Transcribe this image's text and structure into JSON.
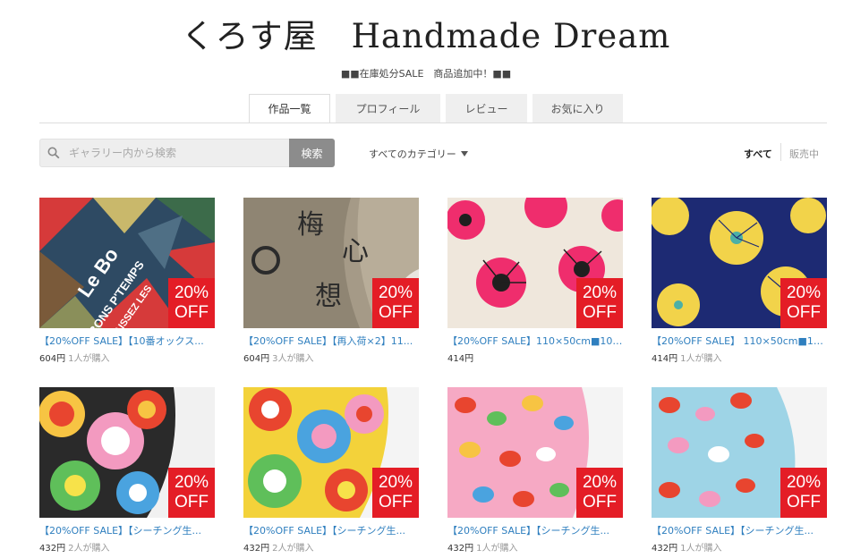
{
  "shop": {
    "title": "くろす屋　Handmade Dream",
    "notice": "■■在庫処分SALE　商品追加中！■■"
  },
  "tabs": [
    {
      "label": "作品一覧",
      "active": true
    },
    {
      "label": "プロフィール",
      "active": false
    },
    {
      "label": "レビュー",
      "active": false
    },
    {
      "label": "お気に入り",
      "active": false
    }
  ],
  "search": {
    "placeholder": "ギャラリー内から検索",
    "button_label": "検索",
    "icon": "search-icon"
  },
  "category": {
    "label": "すべてのカテゴリー",
    "icon": "chevron-down-icon"
  },
  "filters": {
    "all_label": "すべて",
    "on_sale_label": "販売中"
  },
  "badge": {
    "line1": "20%",
    "line2": "OFF",
    "color": "#e41d26"
  },
  "colors": {
    "link": "#2f7fbf",
    "search_button": "#8c8c8c"
  },
  "items": [
    {
      "title": "【20%OFF SALE】【10番オックス...",
      "price": "604円",
      "buyers": "1人が購入",
      "image": "geometric-print-fabric"
    },
    {
      "title": "【20%OFF SALE】【再入荷×2】11...",
      "price": "604円",
      "buyers": "3人が購入",
      "image": "linen-lettering-fabric"
    },
    {
      "title": "【20%OFF SALE】110×50cm■10番...",
      "price": "414円",
      "buyers": "",
      "image": "pink-flower-fabric"
    },
    {
      "title": "【20%OFF SALE】 110×50cm■10...",
      "price": "414円",
      "buyers": "1人が購入",
      "image": "yellow-flower-navy-fabric"
    },
    {
      "title": "【20%OFF SALE】【シーチング生...",
      "price": "432円",
      "buyers": "2人が購入",
      "image": "lollipop-dark-fabric"
    },
    {
      "title": "【20%OFF SALE】【シーチング生...",
      "price": "432円",
      "buyers": "2人が購入",
      "image": "lollipop-bright-fabric"
    },
    {
      "title": "【20%OFF SALE】【シーチング生...",
      "price": "432円",
      "buyers": "1人が購入",
      "image": "candy-pink-fabric"
    },
    {
      "title": "【20%OFF SALE】【シーチング生...",
      "price": "432円",
      "buyers": "1人が購入",
      "image": "candy-blue-fabric"
    }
  ]
}
